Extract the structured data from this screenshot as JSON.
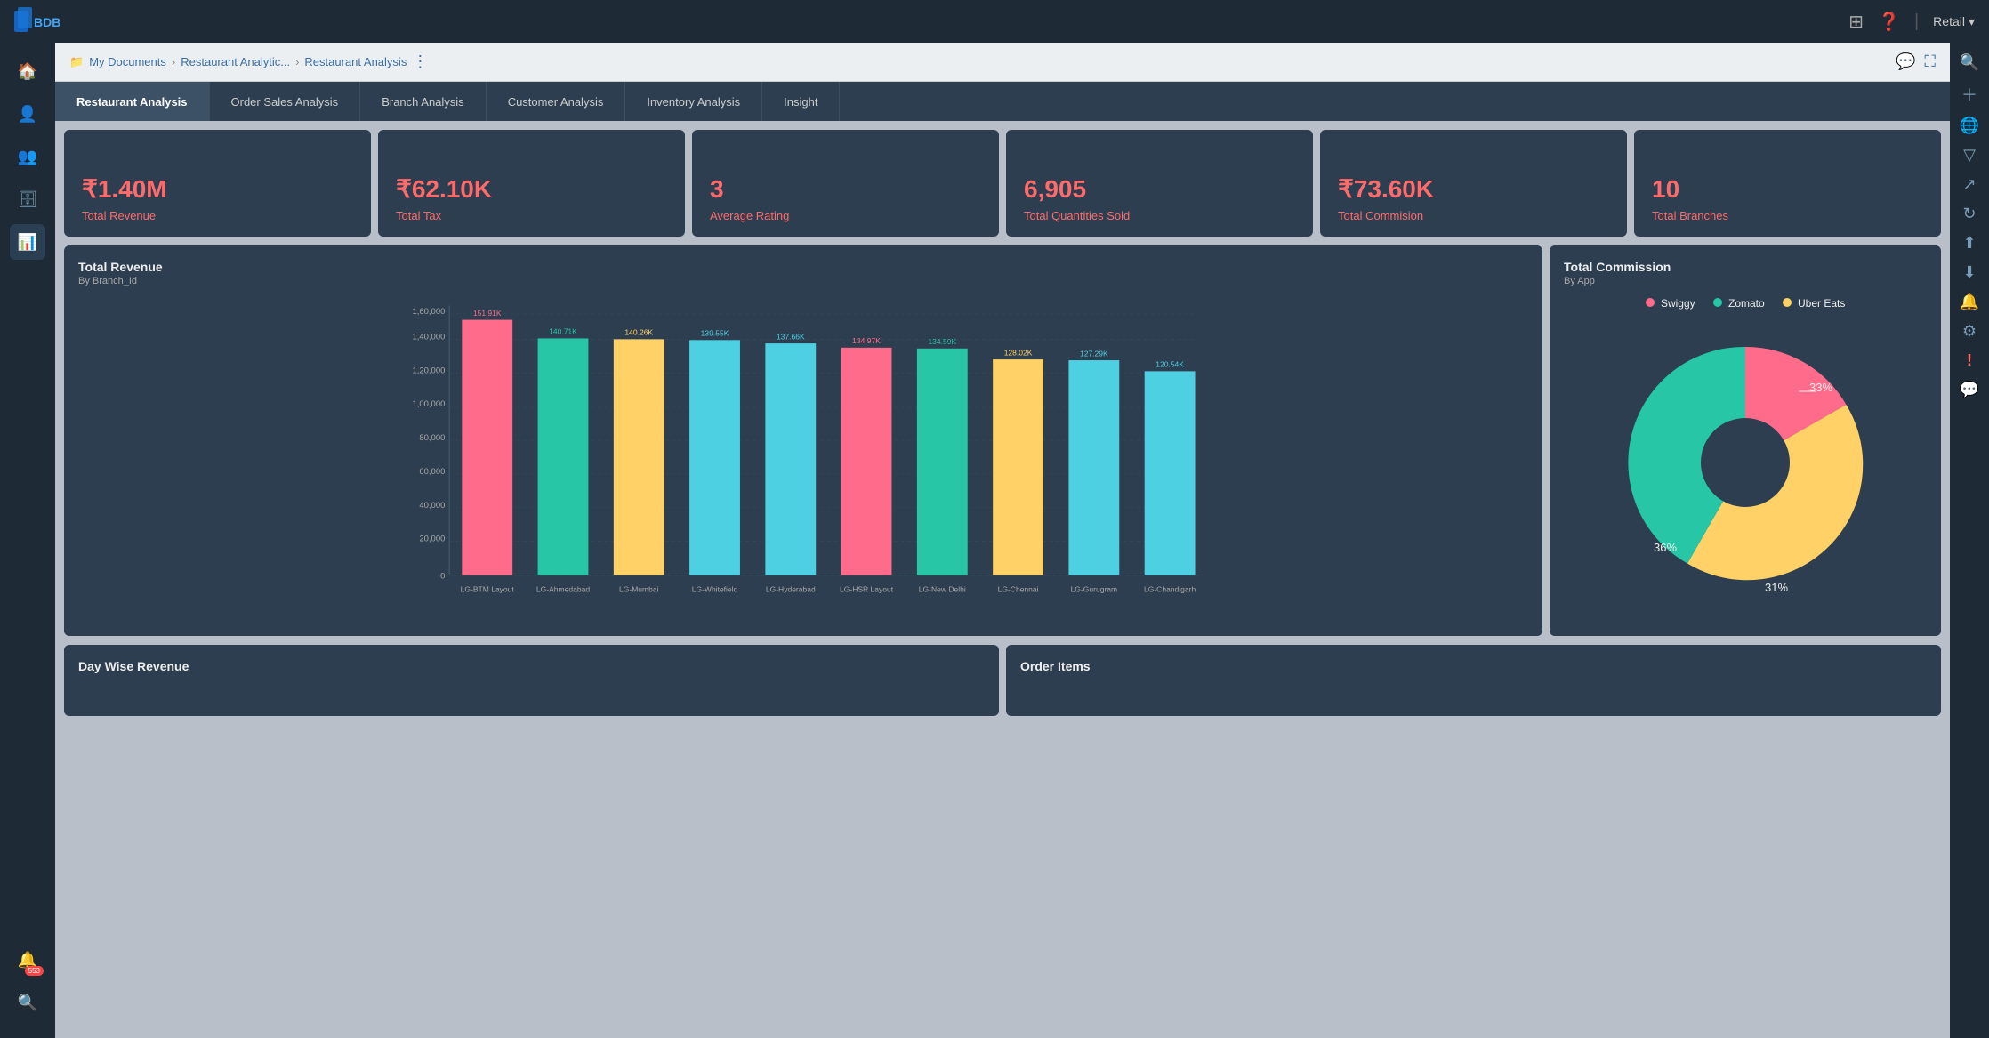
{
  "topbar": {
    "retail_label": "Retail",
    "chevron": "▾"
  },
  "breadcrumb": {
    "items": [
      "My Documents",
      "Restaurant Analytic...",
      "Restaurant Analysis"
    ],
    "menu_icon": "⋮"
  },
  "tabs": [
    {
      "id": "restaurant",
      "label": "Restaurant Analysis",
      "active": true
    },
    {
      "id": "order",
      "label": "Order Sales Analysis",
      "active": false
    },
    {
      "id": "branch",
      "label": "Branch Analysis",
      "active": false
    },
    {
      "id": "customer",
      "label": "Customer Analysis",
      "active": false
    },
    {
      "id": "inventory",
      "label": "Inventory Analysis",
      "active": false
    },
    {
      "id": "insight",
      "label": "Insight",
      "active": false
    }
  ],
  "metrics": [
    {
      "value": "₹1.40M",
      "label": "Total Revenue"
    },
    {
      "value": "₹62.10K",
      "label": "Total Tax"
    },
    {
      "value": "3",
      "label": "Average Rating"
    },
    {
      "value": "6,905",
      "label": "Total Quantities Sold"
    },
    {
      "value": "₹73.60K",
      "label": "Total Commision"
    },
    {
      "value": "10",
      "label": "Total Branches"
    }
  ],
  "bar_chart": {
    "title": "Total Revenue",
    "subtitle": "By Branch_Id",
    "y_labels": [
      "0",
      "20,000",
      "40,000",
      "60,000",
      "80,000",
      "1,00,000",
      "1,20,000",
      "1,40,000",
      "1,60,000"
    ],
    "bars": [
      {
        "label": "LG-BTM Layout",
        "value": 151910,
        "color": "#ff6b8a"
      },
      {
        "label": "LG-Ahmedabad",
        "value": 140710,
        "color": "#26c6a6"
      },
      {
        "label": "LG-Mumbai",
        "value": 140260,
        "color": "#ffd166"
      },
      {
        "label": "LG-Whitefield",
        "value": 139550,
        "color": "#4dd0e1"
      },
      {
        "label": "LG-Hyderabad",
        "value": 137660,
        "color": "#4dd0e1"
      },
      {
        "label": "LG-HSR Layout",
        "value": 134970,
        "color": "#ff6b8a"
      },
      {
        "label": "LG-New Delhi",
        "value": 134590,
        "color": "#26c6a6"
      },
      {
        "label": "LG-Chennai",
        "value": 128020,
        "color": "#ffd166"
      },
      {
        "label": "LG-Gurugram",
        "value": 127290,
        "color": "#4dd0e1"
      },
      {
        "label": "LG-Chandigarh",
        "value": 120540,
        "color": "#4dd0e1"
      }
    ],
    "value_labels": [
      "151.91K",
      "140.71K",
      "140.26K",
      "139.55K",
      "137.66K",
      "134.97K",
      "134.59K",
      "128.02K",
      "127.29K",
      "120.54K"
    ]
  },
  "pie_chart": {
    "title": "Total Commission",
    "subtitle": "By App",
    "segments": [
      {
        "label": "Swiggy",
        "percent": 33,
        "color": "#ff6b8a"
      },
      {
        "label": "Zomato",
        "percent": 31,
        "color": "#26c6a6"
      },
      {
        "label": "Uber Eats",
        "percent": 36,
        "color": "#ffd166"
      }
    ]
  },
  "bottom": {
    "left_title": "Day Wise Revenue",
    "right_title": "Order Items"
  },
  "sidebar_icons": [
    "☰",
    "👤",
    "👥",
    "🗄",
    "📊",
    "🔔",
    "🔍"
  ],
  "right_sidebar_icons": [
    "🔍",
    "+",
    "🌐",
    "⚙",
    "↩",
    "⬇",
    "🔔",
    "🌍",
    "!",
    "💬"
  ]
}
